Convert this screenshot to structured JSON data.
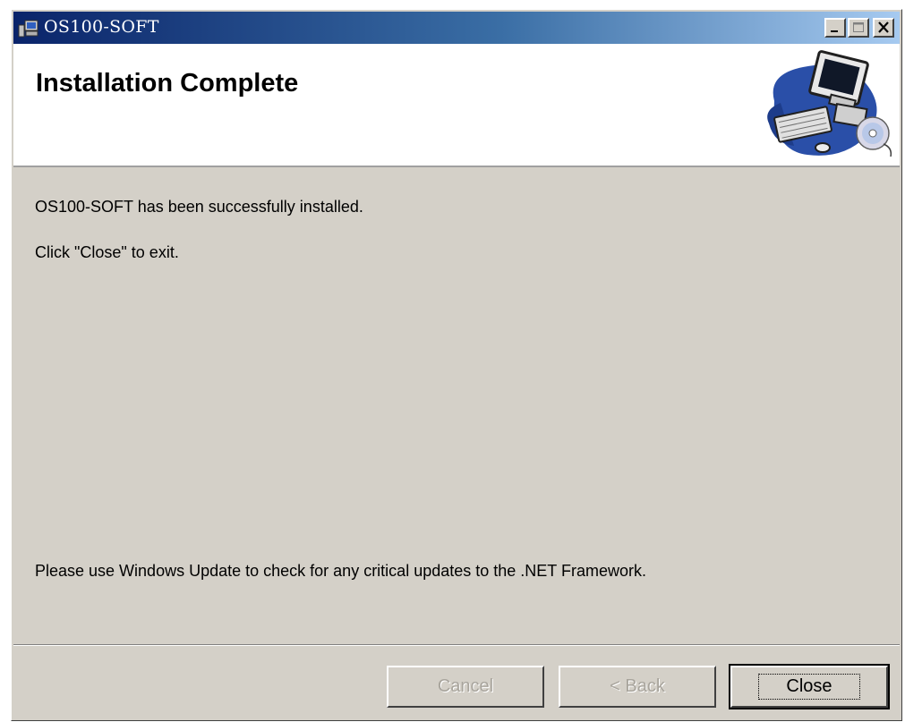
{
  "window": {
    "title": "OS100-SOFT"
  },
  "banner": {
    "title": "Installation Complete"
  },
  "messages": {
    "success": "OS100-SOFT has been successfully installed.",
    "instruction": "Click \"Close\" to exit.",
    "update_notice": "Please use Windows Update to check for any critical updates to the .NET Framework."
  },
  "buttons": {
    "cancel": "Cancel",
    "back": "< Back",
    "close": "Close"
  },
  "colors": {
    "face": "#d4d0c8",
    "titlebar_start": "#0a246a",
    "titlebar_end": "#a6caf0"
  }
}
